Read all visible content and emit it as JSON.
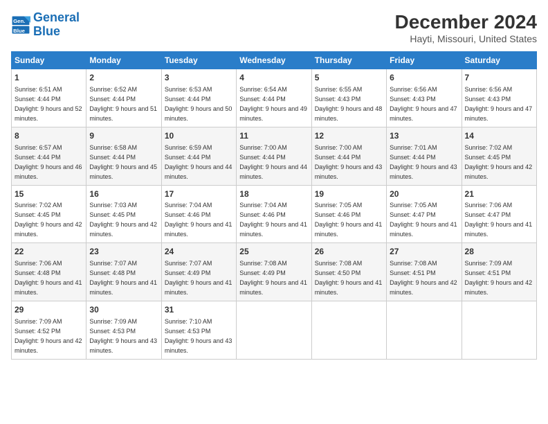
{
  "logo": {
    "line1": "General",
    "line2": "Blue"
  },
  "title": "December 2024",
  "subtitle": "Hayti, Missouri, United States",
  "calendar": {
    "headers": [
      "Sunday",
      "Monday",
      "Tuesday",
      "Wednesday",
      "Thursday",
      "Friday",
      "Saturday"
    ],
    "weeks": [
      [
        {
          "day": "1",
          "sunrise": "6:51 AM",
          "sunset": "4:44 PM",
          "daylight": "9 hours and 52 minutes."
        },
        {
          "day": "2",
          "sunrise": "6:52 AM",
          "sunset": "4:44 PM",
          "daylight": "9 hours and 51 minutes."
        },
        {
          "day": "3",
          "sunrise": "6:53 AM",
          "sunset": "4:44 PM",
          "daylight": "9 hours and 50 minutes."
        },
        {
          "day": "4",
          "sunrise": "6:54 AM",
          "sunset": "4:44 PM",
          "daylight": "9 hours and 49 minutes."
        },
        {
          "day": "5",
          "sunrise": "6:55 AM",
          "sunset": "4:43 PM",
          "daylight": "9 hours and 48 minutes."
        },
        {
          "day": "6",
          "sunrise": "6:56 AM",
          "sunset": "4:43 PM",
          "daylight": "9 hours and 47 minutes."
        },
        {
          "day": "7",
          "sunrise": "6:56 AM",
          "sunset": "4:43 PM",
          "daylight": "9 hours and 47 minutes."
        }
      ],
      [
        {
          "day": "8",
          "sunrise": "6:57 AM",
          "sunset": "4:44 PM",
          "daylight": "9 hours and 46 minutes."
        },
        {
          "day": "9",
          "sunrise": "6:58 AM",
          "sunset": "4:44 PM",
          "daylight": "9 hours and 45 minutes."
        },
        {
          "day": "10",
          "sunrise": "6:59 AM",
          "sunset": "4:44 PM",
          "daylight": "9 hours and 44 minutes."
        },
        {
          "day": "11",
          "sunrise": "7:00 AM",
          "sunset": "4:44 PM",
          "daylight": "9 hours and 44 minutes."
        },
        {
          "day": "12",
          "sunrise": "7:00 AM",
          "sunset": "4:44 PM",
          "daylight": "9 hours and 43 minutes."
        },
        {
          "day": "13",
          "sunrise": "7:01 AM",
          "sunset": "4:44 PM",
          "daylight": "9 hours and 43 minutes."
        },
        {
          "day": "14",
          "sunrise": "7:02 AM",
          "sunset": "4:45 PM",
          "daylight": "9 hours and 42 minutes."
        }
      ],
      [
        {
          "day": "15",
          "sunrise": "7:02 AM",
          "sunset": "4:45 PM",
          "daylight": "9 hours and 42 minutes."
        },
        {
          "day": "16",
          "sunrise": "7:03 AM",
          "sunset": "4:45 PM",
          "daylight": "9 hours and 42 minutes."
        },
        {
          "day": "17",
          "sunrise": "7:04 AM",
          "sunset": "4:46 PM",
          "daylight": "9 hours and 41 minutes."
        },
        {
          "day": "18",
          "sunrise": "7:04 AM",
          "sunset": "4:46 PM",
          "daylight": "9 hours and 41 minutes."
        },
        {
          "day": "19",
          "sunrise": "7:05 AM",
          "sunset": "4:46 PM",
          "daylight": "9 hours and 41 minutes."
        },
        {
          "day": "20",
          "sunrise": "7:05 AM",
          "sunset": "4:47 PM",
          "daylight": "9 hours and 41 minutes."
        },
        {
          "day": "21",
          "sunrise": "7:06 AM",
          "sunset": "4:47 PM",
          "daylight": "9 hours and 41 minutes."
        }
      ],
      [
        {
          "day": "22",
          "sunrise": "7:06 AM",
          "sunset": "4:48 PM",
          "daylight": "9 hours and 41 minutes."
        },
        {
          "day": "23",
          "sunrise": "7:07 AM",
          "sunset": "4:48 PM",
          "daylight": "9 hours and 41 minutes."
        },
        {
          "day": "24",
          "sunrise": "7:07 AM",
          "sunset": "4:49 PM",
          "daylight": "9 hours and 41 minutes."
        },
        {
          "day": "25",
          "sunrise": "7:08 AM",
          "sunset": "4:49 PM",
          "daylight": "9 hours and 41 minutes."
        },
        {
          "day": "26",
          "sunrise": "7:08 AM",
          "sunset": "4:50 PM",
          "daylight": "9 hours and 41 minutes."
        },
        {
          "day": "27",
          "sunrise": "7:08 AM",
          "sunset": "4:51 PM",
          "daylight": "9 hours and 42 minutes."
        },
        {
          "day": "28",
          "sunrise": "7:09 AM",
          "sunset": "4:51 PM",
          "daylight": "9 hours and 42 minutes."
        }
      ],
      [
        {
          "day": "29",
          "sunrise": "7:09 AM",
          "sunset": "4:52 PM",
          "daylight": "9 hours and 42 minutes."
        },
        {
          "day": "30",
          "sunrise": "7:09 AM",
          "sunset": "4:53 PM",
          "daylight": "9 hours and 43 minutes."
        },
        {
          "day": "31",
          "sunrise": "7:10 AM",
          "sunset": "4:53 PM",
          "daylight": "9 hours and 43 minutes."
        },
        null,
        null,
        null,
        null
      ]
    ]
  }
}
